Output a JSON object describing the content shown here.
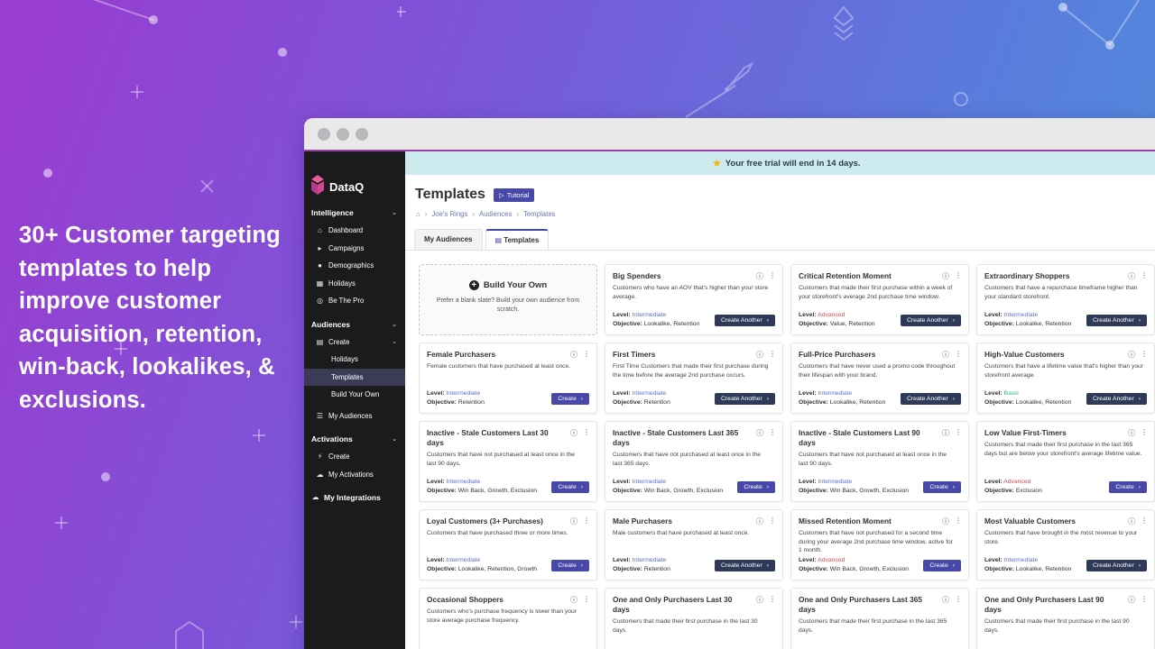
{
  "tagline": "30+ Customer targeting templates to help improve customer acquisition, retention, win-back, lookalikes, & exclusions.",
  "brand": {
    "name": "DataQ"
  },
  "sidebar": {
    "intelligence": {
      "label": "Intelligence",
      "items": [
        {
          "label": "Dashboard",
          "icon": "home-icon"
        },
        {
          "label": "Campaigns",
          "icon": "megaphone-icon"
        },
        {
          "label": "Demographics",
          "icon": "people-icon"
        },
        {
          "label": "Holidays",
          "icon": "gift-icon"
        },
        {
          "label": "Be The Pro",
          "icon": "target-icon"
        }
      ]
    },
    "audiences": {
      "label": "Audiences",
      "create": "Create",
      "sub": [
        {
          "label": "Holidays"
        },
        {
          "label": "Templates"
        },
        {
          "label": "Build Your Own"
        }
      ],
      "my_audiences": "My Audiences"
    },
    "activations": {
      "label": "Activations",
      "create": "Create",
      "my_activations": "My Activations"
    },
    "integrations": "My Integrations"
  },
  "trial_banner": "Your free trial will end in 14 days.",
  "page": {
    "title": "Templates",
    "tutorial": "Tutorial",
    "breadcrumb": [
      "Joe's Rings",
      "Audiences",
      "Templates"
    ]
  },
  "tabs": [
    "My Audiences",
    "Templates"
  ],
  "build_own": {
    "title": "Build Your Own",
    "desc": "Prefer a blank slate? Build your own audience from scratch."
  },
  "labels": {
    "level": "Level:",
    "objective": "Objective:"
  },
  "cards": [
    {
      "title": "Big Spenders",
      "desc": "Customers who have an AOV that's higher than your store average.",
      "level": "Intermediate",
      "objective": "Lookalike, Retention",
      "button": "Create Another"
    },
    {
      "title": "Critical Retention Moment",
      "desc": "Customers that made their first purchase within a week of your storefront's average 2nd purchase time window.",
      "level": "Advanced",
      "objective": "Value, Retention",
      "button": "Create Another"
    },
    {
      "title": "Extraordinary Shoppers",
      "desc": "Customers that have a repurchase timeframe higher than your standard storefront.",
      "level": "Intermediate",
      "objective": "Lookalike, Retention",
      "button": "Create Another"
    },
    {
      "title": "Female Purchasers",
      "desc": "Female customers that have purchased at least once.",
      "level": "Intermediate",
      "objective": "Retention",
      "button": "Create"
    },
    {
      "title": "First Timers",
      "desc": "First Time Customers that made their first purchase during the time before the average 2nd purchase occurs.",
      "level": "Intermediate",
      "objective": "Retention",
      "button": "Create Another"
    },
    {
      "title": "Full-Price Purchasers",
      "desc": "Customers that have never used a promo code throughout their lifespan with your brand.",
      "level": "Intermediate",
      "objective": "Lookalike, Retention",
      "button": "Create Another"
    },
    {
      "title": "High-Value Customers",
      "desc": "Customers that have a lifetime value that's higher than your storefront average.",
      "level": "Basic",
      "objective": "Lookalike, Retention",
      "button": "Create Another"
    },
    {
      "title": "Inactive - Stale Customers Last 30 days",
      "desc": "Customers that have not purchased at least once in the last 90 days.",
      "level": "Intermediate",
      "objective": "Win Back, Growth, Exclusion",
      "button": "Create"
    },
    {
      "title": "Inactive - Stale Customers Last 365 days",
      "desc": "Customers that have not purchased at least once in the last 365 days.",
      "level": "Intermediate",
      "objective": "Win Back, Growth, Exclusion",
      "button": "Create"
    },
    {
      "title": "Inactive - Stale Customers Last 90 days",
      "desc": "Customers that have not purchased at least once in the last 90 days.",
      "level": "Intermediate",
      "objective": "Win Back, Growth, Exclusion",
      "button": "Create"
    },
    {
      "title": "Low Value First-Timers",
      "desc": "Customers that made their first purchase in the last 365 days but are below your storefront's average lifetime value.",
      "level": "Advanced",
      "objective": "Exclusion",
      "button": "Create"
    },
    {
      "title": "Loyal Customers (3+ Purchases)",
      "desc": "Customers that have purchased three or more times.",
      "level": "Intermediate",
      "objective": "Lookalike, Retention, Growth",
      "button": "Create"
    },
    {
      "title": "Male Purchasers",
      "desc": "Male customers that have purchased at least once.",
      "level": "Intermediate",
      "objective": "Retention",
      "button": "Create Another"
    },
    {
      "title": "Missed Retention Moment",
      "desc": "Customers that have not purchased for a second time during your average 2nd purchase time window, active for 1 month.",
      "level": "Advanced",
      "objective": "Win Back, Growth, Exclusion",
      "button": "Create"
    },
    {
      "title": "Most Valuable Customers",
      "desc": "Customers that have brought in the most revenue to your store.",
      "level": "Intermediate",
      "objective": "Lookalike, Retention",
      "button": "Create Another"
    },
    {
      "title": "Occasional Shoppers",
      "desc": "Customers who's purchase frequency is lower than your store average purchase frequency.",
      "level": "",
      "objective": "",
      "button": ""
    },
    {
      "title": "One and Only Purchasers Last 30 days",
      "desc": "Customers that made their first purchase in the last 30 days.",
      "level": "",
      "objective": "",
      "button": ""
    },
    {
      "title": "One and Only Purchasers Last 365 days",
      "desc": "Customers that made their first purchase in the last 365 days.",
      "level": "",
      "objective": "",
      "button": ""
    },
    {
      "title": "One and Only Purchasers Last 90 days",
      "desc": "Customers that made their first purchase in the last 90 days.",
      "level": "",
      "objective": "",
      "button": ""
    }
  ],
  "colors": {
    "accent": "#4848a8",
    "dark_button": "#2e3a58",
    "sidebar": "#1b1b1d",
    "banner": "#cdebef",
    "level_intermediate": "#5b6fd0",
    "level_advanced": "#e04848",
    "level_basic": "#2bb58e"
  }
}
